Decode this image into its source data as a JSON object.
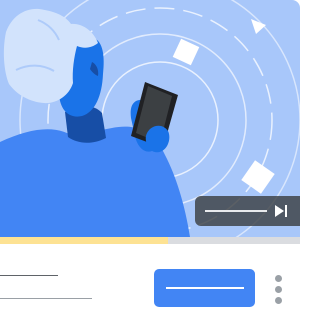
{
  "card": {
    "illustration_icon": "person-holding-phone-illustration",
    "progress": 0.56,
    "skip_icon": "skip-next-icon",
    "more_icon": "more-vert-icon",
    "colors": {
      "background": "#a8c7fa",
      "accent": "#4285f4",
      "progress": "#fde293",
      "track": "#dadce0"
    }
  }
}
